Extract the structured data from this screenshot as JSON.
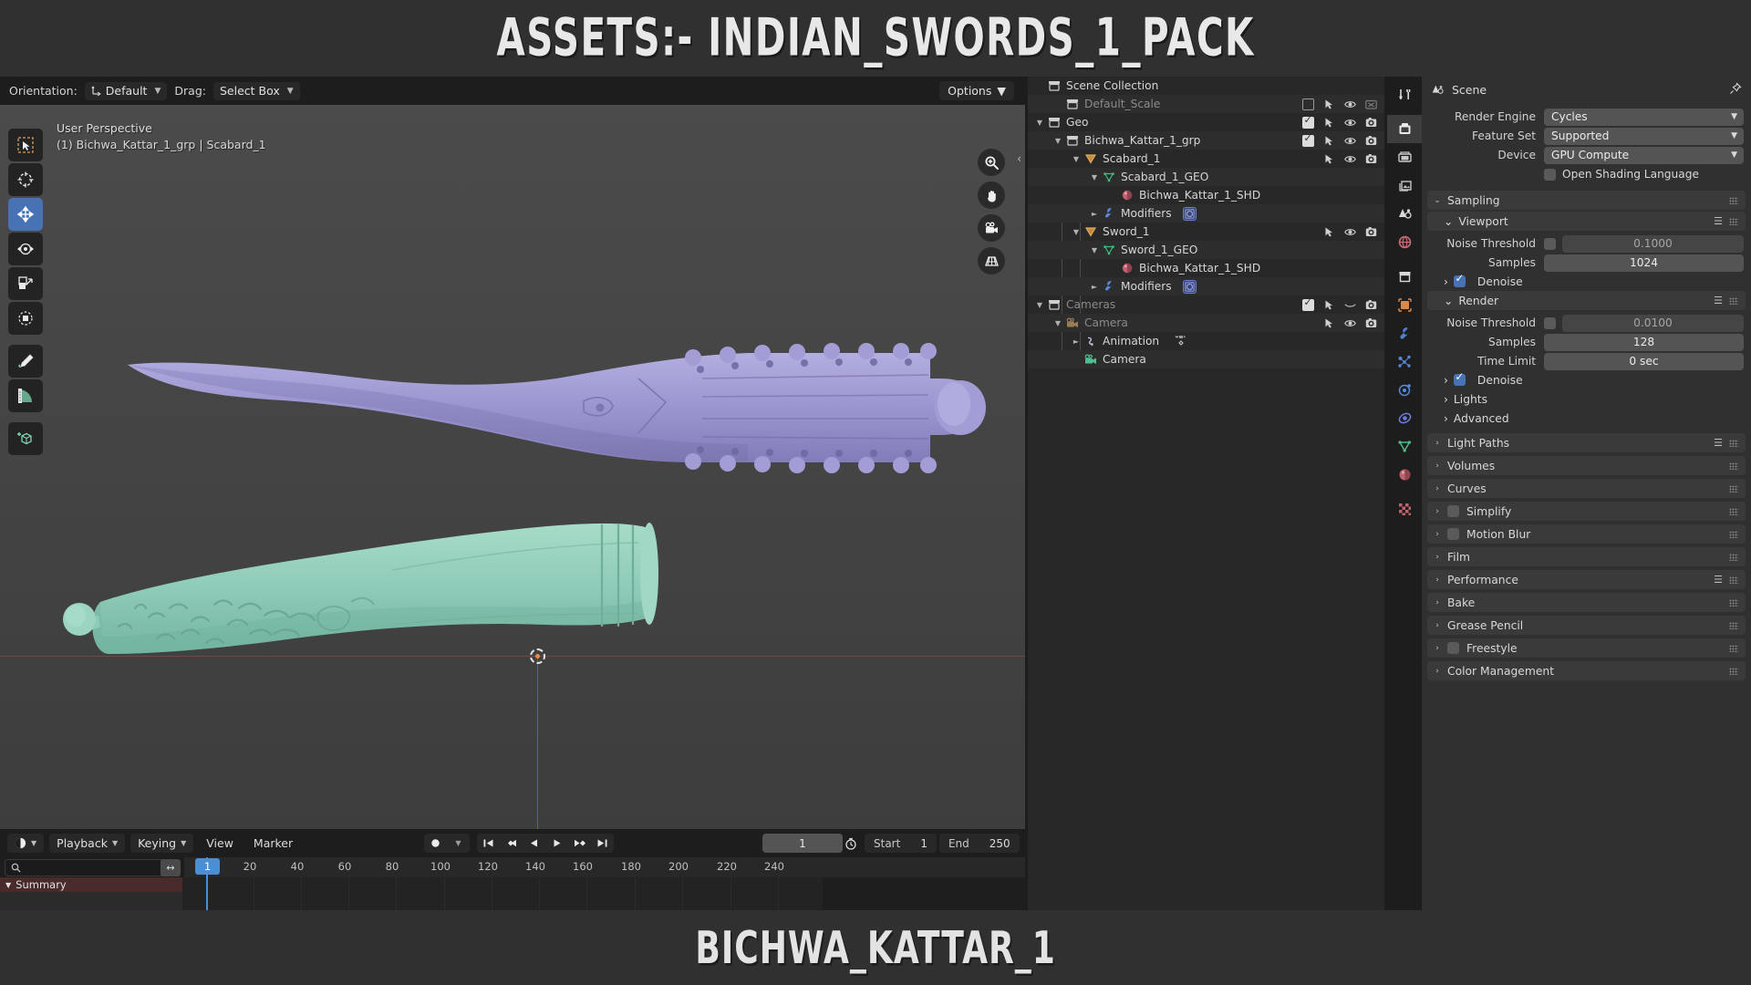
{
  "banner": {
    "title": "ASSETS:- INDIAN_SWORDS_1_PACK",
    "footer": "BICHWA_KATTAR_1"
  },
  "viewport_header": {
    "orientation_label": "Orientation:",
    "orientation_value": "Default",
    "drag_label": "Drag:",
    "drag_value": "Select Box",
    "options_label": "Options"
  },
  "viewport": {
    "perspective": "User Perspective",
    "active_object": "(1) Bichwa_Kattar_1_grp | Scabard_1",
    "tools": [
      {
        "name": "tweak-select-tool",
        "icon": "select-box-icon",
        "selected": false
      },
      {
        "name": "cursor-tool",
        "icon": "cursor-icon",
        "selected": false
      },
      {
        "name": "move-tool",
        "icon": "move-icon",
        "selected": true
      },
      {
        "name": "rotate-tool",
        "icon": "rotate-icon",
        "selected": false
      },
      {
        "name": "scale-tool",
        "icon": "scale-icon",
        "selected": false
      },
      {
        "name": "transform-tool",
        "icon": "transform-icon",
        "selected": false
      },
      {
        "name": "annotate-tool",
        "icon": "pencil-icon",
        "selected": false
      },
      {
        "name": "measure-tool",
        "icon": "ruler-icon",
        "selected": false
      },
      {
        "name": "add-cube-tool",
        "icon": "add-cube-icon",
        "selected": false
      }
    ],
    "gizmos": [
      {
        "name": "zoom-gizmo",
        "icon": "magnifier-plus-icon"
      },
      {
        "name": "pan-gizmo",
        "icon": "hand-icon"
      },
      {
        "name": "camera-view-gizmo",
        "icon": "camera-icon"
      },
      {
        "name": "toggle-perspective-gizmo",
        "icon": "grid-perspective-icon"
      }
    ],
    "objects": [
      {
        "name": "scabard-mesh",
        "color": "#9b97cf",
        "label": "Scabard_1"
      },
      {
        "name": "sword-mesh",
        "color": "#8ecbb8",
        "label": "Sword_1"
      }
    ]
  },
  "timeline": {
    "editor_type": "timeline-editor-icon",
    "menus": [
      "Playback",
      "Keying",
      "View",
      "Marker"
    ],
    "menus_with_chevron": [
      "Playback",
      "Keying"
    ],
    "record_icon": "record-icon",
    "transport": [
      "jump-start-icon",
      "prev-keyframe-icon",
      "play-reverse-icon",
      "play-icon",
      "next-keyframe-icon",
      "jump-end-icon"
    ],
    "current_frame": "1",
    "timer_icon": "stopwatch-icon",
    "start_label": "Start",
    "start_value": "1",
    "end_label": "End",
    "end_value": "250",
    "search_placeholder": "",
    "search_icon": "search-icon",
    "filter_icon": "expand-horizontal-icon",
    "channel_summary": "Summary",
    "ticks": [
      "1",
      "20",
      "40",
      "60",
      "80",
      "100",
      "120",
      "140",
      "160",
      "180",
      "200",
      "220",
      "240"
    ],
    "playhead_frame": "1"
  },
  "outliner": {
    "rows": [
      {
        "indent": 0,
        "tri": "",
        "icon": "collection-icon",
        "label": "Scene Collection",
        "muted": false,
        "controls": []
      },
      {
        "indent": 1,
        "tri": "",
        "icon": "collection-icon",
        "label": "Default_Scale",
        "muted": true,
        "controls": [
          "checkbox-off",
          "selectable-icon",
          "eye-icon",
          "camera-disabled-icon"
        ]
      },
      {
        "indent": 0,
        "tri": "down",
        "icon": "collection-icon",
        "label": "Geo",
        "muted": false,
        "controls": [
          "checkbox-on",
          "selectable-icon",
          "eye-icon",
          "camera-icon"
        ]
      },
      {
        "indent": 1,
        "tri": "down",
        "icon": "collection-icon",
        "label": "Bichwa_Kattar_1_grp",
        "muted": false,
        "controls": [
          "checkbox-on",
          "selectable-icon",
          "eye-icon",
          "camera-icon"
        ]
      },
      {
        "indent": 2,
        "tri": "down",
        "icon": "mesh-object-icon",
        "label": "Scabard_1",
        "muted": false,
        "controls": [
          "selectable-icon",
          "eye-icon",
          "camera-icon"
        ]
      },
      {
        "indent": 3,
        "tri": "down",
        "icon": "mesh-data-icon",
        "label": "Scabard_1_GEO",
        "muted": false,
        "controls": []
      },
      {
        "indent": 4,
        "tri": "",
        "icon": "material-icon",
        "label": "Bichwa_Kattar_1_SHD",
        "muted": false,
        "controls": []
      },
      {
        "indent": 3,
        "tri": "right",
        "icon": "wrench-icon",
        "label": "Modifiers",
        "muted": false,
        "badge": "subsurf-modifier-icon",
        "controls": []
      },
      {
        "indent": 2,
        "tri": "down",
        "icon": "mesh-object-icon",
        "label": "Sword_1",
        "muted": false,
        "controls": [
          "selectable-icon",
          "eye-icon",
          "camera-icon"
        ]
      },
      {
        "indent": 3,
        "tri": "down",
        "icon": "mesh-data-icon",
        "label": "Sword_1_GEO",
        "muted": false,
        "controls": []
      },
      {
        "indent": 4,
        "tri": "",
        "icon": "material-icon",
        "label": "Bichwa_Kattar_1_SHD",
        "muted": false,
        "controls": []
      },
      {
        "indent": 3,
        "tri": "right",
        "icon": "wrench-icon",
        "label": "Modifiers",
        "muted": false,
        "badge": "subsurf-modifier-icon",
        "controls": []
      },
      {
        "indent": 0,
        "tri": "down",
        "icon": "collection-icon",
        "label": "Cameras",
        "muted": true,
        "controls": [
          "checkbox-on",
          "selectable-icon",
          "eye-closed-icon",
          "camera-icon"
        ]
      },
      {
        "indent": 1,
        "tri": "down",
        "icon": "camera-object-icon",
        "label": "Camera",
        "muted": true,
        "controls": [
          "selectable-icon",
          "eye-icon",
          "camera-icon"
        ]
      },
      {
        "indent": 2,
        "tri": "right",
        "icon": "animation-icon",
        "label": "Animation",
        "muted": false,
        "badge2": "keyframe-icon",
        "controls": []
      },
      {
        "indent": 2,
        "tri": "",
        "icon": "camera-data-icon",
        "label": "Camera",
        "muted": false,
        "controls": []
      }
    ]
  },
  "properties_rail": [
    {
      "name": "tool-tab",
      "icon": "tool-icon",
      "selected": false
    },
    {
      "name": "render-tab",
      "icon": "camera-back-icon",
      "selected": true
    },
    {
      "name": "output-tab",
      "icon": "printer-icon",
      "selected": false
    },
    {
      "name": "view-layer-tab",
      "icon": "images-icon",
      "selected": false
    },
    {
      "name": "scene-tab",
      "icon": "scene-cone-icon",
      "selected": false
    },
    {
      "name": "world-tab",
      "icon": "world-icon",
      "selected": false
    },
    {
      "name": "collection-tab",
      "icon": "collection-icon",
      "selected": false
    },
    {
      "name": "object-tab",
      "icon": "object-square-icon",
      "selected": false
    },
    {
      "name": "modifier-tab",
      "icon": "wrench-icon",
      "selected": false
    },
    {
      "name": "particles-tab",
      "icon": "particles-icon",
      "selected": false
    },
    {
      "name": "physics-tab",
      "icon": "physics-orbit-icon",
      "selected": false
    },
    {
      "name": "constraints-tab",
      "icon": "constraint-icon",
      "selected": false
    },
    {
      "name": "data-tab",
      "icon": "mesh-data-icon",
      "selected": false
    },
    {
      "name": "material-tab",
      "icon": "material-icon",
      "selected": false
    },
    {
      "name": "texture-tab",
      "icon": "checker-texture-icon",
      "selected": false
    }
  ],
  "properties": {
    "breadcrumb": "Scene",
    "breadcrumb_icon": "scene-icon",
    "pin_icon": "pin-icon",
    "fields": [
      {
        "label": "Render Engine",
        "value": "Cycles"
      },
      {
        "label": "Feature Set",
        "value": "Supported"
      },
      {
        "label": "Device",
        "value": "GPU Compute"
      }
    ],
    "osl_label": "Open Shading Language",
    "osl_checked": false,
    "sampling": {
      "title": "Sampling",
      "viewport": {
        "title": "Viewport",
        "noise_threshold_label": "Noise Threshold",
        "noise_threshold_value": "0.1000",
        "noise_threshold_enabled": false,
        "samples_label": "Samples",
        "samples_value": "1024",
        "denoise_label": "Denoise",
        "denoise_checked": true
      },
      "render": {
        "title": "Render",
        "noise_threshold_label": "Noise Threshold",
        "noise_threshold_value": "0.0100",
        "noise_threshold_enabled": false,
        "samples_label": "Samples",
        "samples_value": "128",
        "time_limit_label": "Time Limit",
        "time_limit_value": "0 sec",
        "denoise_label": "Denoise",
        "denoise_checked": true
      },
      "lights_label": "Lights",
      "advanced_label": "Advanced"
    },
    "panels": [
      {
        "label": "Light Paths",
        "checkbox": false,
        "list": true
      },
      {
        "label": "Volumes",
        "checkbox": false,
        "list": false
      },
      {
        "label": "Curves",
        "checkbox": false,
        "list": false
      },
      {
        "label": "Simplify",
        "checkbox": true,
        "checked": false,
        "list": false
      },
      {
        "label": "Motion Blur",
        "checkbox": true,
        "checked": false,
        "list": false
      },
      {
        "label": "Film",
        "checkbox": false,
        "list": false
      },
      {
        "label": "Performance",
        "checkbox": false,
        "list": true
      },
      {
        "label": "Bake",
        "checkbox": false,
        "list": false
      },
      {
        "label": "Grease Pencil",
        "checkbox": false,
        "list": false
      },
      {
        "label": "Freestyle",
        "checkbox": true,
        "checked": false,
        "list": false
      },
      {
        "label": "Color Management",
        "checkbox": false,
        "list": false
      }
    ]
  }
}
